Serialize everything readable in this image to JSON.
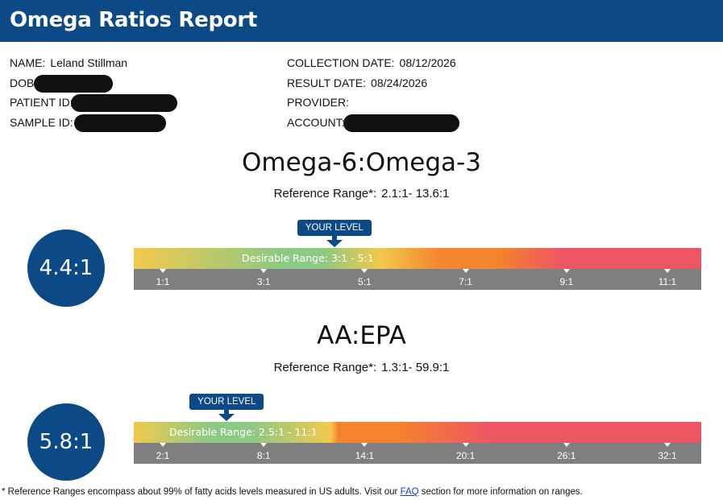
{
  "header": {
    "title": "Omega Ratios Report"
  },
  "patient_info": {
    "left": [
      {
        "label": "NAME:",
        "value": "Leland Stillman",
        "redacted": false
      },
      {
        "label": "DOB",
        "value": "",
        "redacted": true
      },
      {
        "label": "PATIENT ID:",
        "value": "",
        "redacted": true
      },
      {
        "label": "SAMPLE ID:",
        "value": "",
        "redacted": true
      }
    ],
    "right": [
      {
        "label": "COLLECTION DATE:",
        "value": "08/12/2026",
        "redacted": false
      },
      {
        "label": "RESULT DATE:",
        "value": "08/24/2026",
        "redacted": false
      },
      {
        "label": "PROVIDER:",
        "value": "",
        "redacted": false
      },
      {
        "label": "ACCOUNT:",
        "value": "",
        "redacted": true
      }
    ]
  },
  "sections": [
    {
      "title": "Omega-6:Omega-3",
      "reference_label": "Reference Range*:",
      "reference_value": "2.1:1- 13.6:1",
      "result": "4.4:1",
      "result_value": 4.4,
      "marker_label": "YOUR LEVEL",
      "desirable_label": "Desirable Range: 3:1 - 5:1",
      "desirable_min": 3,
      "desirable_max": 5,
      "ticks": [
        {
          "label": "1:1",
          "value": 1
        },
        {
          "label": "3:1",
          "value": 3
        },
        {
          "label": "5:1",
          "value": 5
        },
        {
          "label": "7:1",
          "value": 7
        },
        {
          "label": "9:1",
          "value": 9
        },
        {
          "label": "11:1",
          "value": 11
        }
      ],
      "colors": {
        "yellow": "#f2c94c",
        "green": "#8cc985",
        "orange": "#f5842c",
        "red": "#ee5563"
      }
    },
    {
      "title": "AA:EPA",
      "reference_label": "Reference Range*:",
      "reference_value": "1.3:1- 59.9:1",
      "result": "5.8:1",
      "result_value": 5.8,
      "marker_label": "YOUR LEVEL",
      "desirable_label": "Desirable Range: 2.5:1 - 11:1",
      "desirable_min": 2.5,
      "desirable_max": 11,
      "ticks": [
        {
          "label": "2:1",
          "value": 2
        },
        {
          "label": "8:1",
          "value": 8
        },
        {
          "label": "14:1",
          "value": 14
        },
        {
          "label": "20:1",
          "value": 20
        },
        {
          "label": "26:1",
          "value": 26
        },
        {
          "label": "32:1",
          "value": 32
        }
      ],
      "colors": {
        "yellow": "#f2c94c",
        "green": "#8cc985",
        "orange": "#f5842c",
        "red": "#ee5563"
      }
    }
  ],
  "footnote": {
    "before": "* Reference Ranges encompass about 99% of fatty acids levels measured in US adults. Visit our ",
    "link": "FAQ",
    "after": " section for more information on ranges."
  },
  "colors": {
    "brand": "#0b4a86",
    "scale_gray": "#7f7f7f"
  }
}
